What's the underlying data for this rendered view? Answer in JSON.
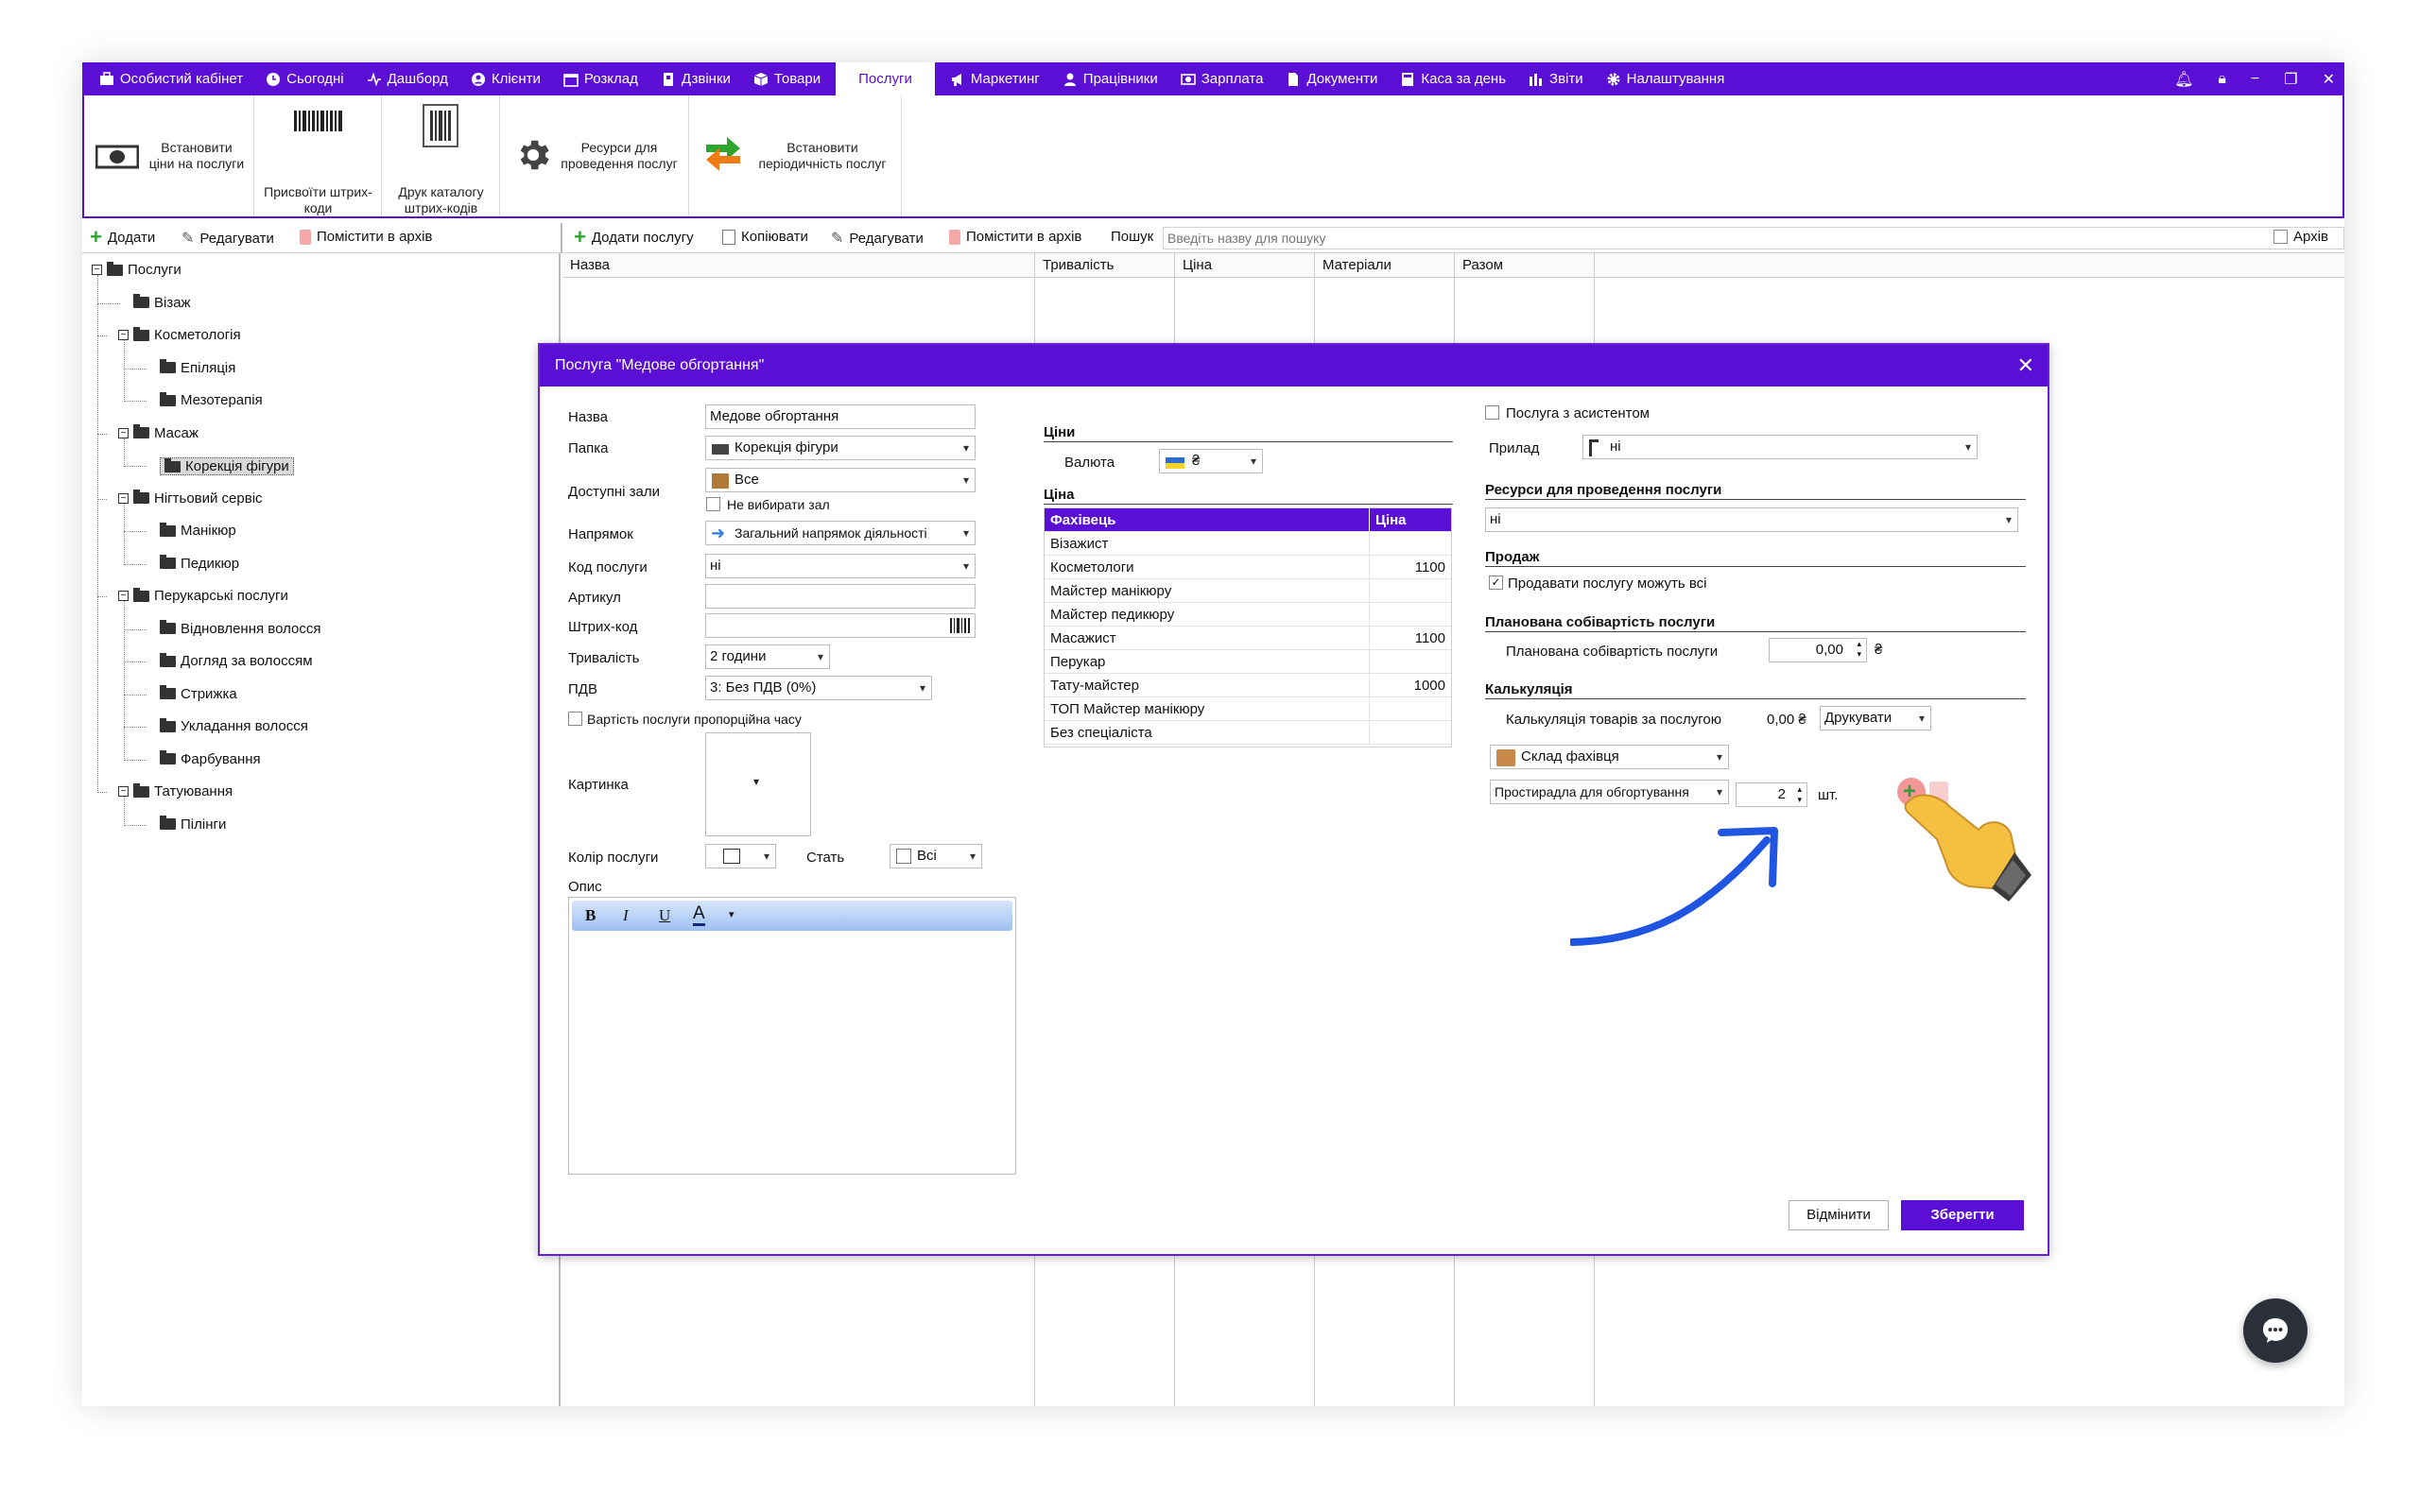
{
  "nav": {
    "items": [
      {
        "label": "Особистий кабінет",
        "icon": "briefcase-icon"
      },
      {
        "label": "Сьогодні",
        "icon": "clock-icon"
      },
      {
        "label": "Дашборд",
        "icon": "pulse-icon"
      },
      {
        "label": "Клієнти",
        "icon": "user-circle-icon"
      },
      {
        "label": "Розклад",
        "icon": "calendar-icon"
      },
      {
        "label": "Дзвінки",
        "icon": "phone-book-icon"
      },
      {
        "label": "Товари",
        "icon": "box-icon"
      },
      {
        "label": "Послуги",
        "icon": "",
        "active": true
      },
      {
        "label": "Маркетинг",
        "icon": "megaphone-icon"
      },
      {
        "label": "Працівники",
        "icon": "person-icon"
      },
      {
        "label": "Зарплата",
        "icon": "money-icon"
      },
      {
        "label": "Документи",
        "icon": "document-icon"
      },
      {
        "label": "Каса за день",
        "icon": "register-icon"
      },
      {
        "label": "Звіти",
        "icon": "bar-chart-icon"
      },
      {
        "label": "Налаштування",
        "icon": "gear-icon"
      }
    ],
    "window_controls": [
      "bell-icon",
      "lock-icon",
      "minimize-icon",
      "restore-icon",
      "close-icon"
    ]
  },
  "ribbon": {
    "set_prices": "Встановити\nціни на послуги",
    "assign_barcodes": "Присвоїти штрих-\nкоди",
    "print_catalog": "Друк каталогу\nштрих-кодів",
    "resources": "Ресурси для\nпроведення послуг",
    "periodicity": "Встановити\nперіодичність послуг"
  },
  "left_toolbar": {
    "add": "Додати",
    "edit": "Редагувати",
    "archive": "Помістити в архів"
  },
  "right_toolbar": {
    "add_service": "Додати послугу",
    "copy": "Копіювати",
    "edit": "Редагувати",
    "archive": "Помістити в архів",
    "search_label": "Пошук",
    "search_placeholder": "Введіть назву для пошуку",
    "archive_checkbox": "Архів"
  },
  "tree": [
    {
      "label": "Послуги",
      "level": 0,
      "expander": "−"
    },
    {
      "label": "Візаж",
      "level": 1
    },
    {
      "label": "Косметологія",
      "level": 1,
      "expander": "−"
    },
    {
      "label": "Епіляція",
      "level": 2
    },
    {
      "label": "Мезотерапія",
      "level": 2
    },
    {
      "label": "Масаж",
      "level": 1,
      "expander": "−"
    },
    {
      "label": "Корекція фігури",
      "level": 2,
      "selected": true
    },
    {
      "label": "Нігтьовий сервіс",
      "level": 1,
      "expander": "−"
    },
    {
      "label": "Манікюр",
      "level": 2
    },
    {
      "label": "Педикюр",
      "level": 2
    },
    {
      "label": "Перукарські послуги",
      "level": 1,
      "expander": "−"
    },
    {
      "label": "Відновлення волосся",
      "level": 2
    },
    {
      "label": "Догляд за волоссям",
      "level": 2
    },
    {
      "label": "Стрижка",
      "level": 2
    },
    {
      "label": "Укладання волосся",
      "level": 2
    },
    {
      "label": "Фарбування",
      "level": 2
    },
    {
      "label": "Татуювання",
      "level": 1,
      "expander": "−"
    },
    {
      "label": "Пілінги",
      "level": 2
    }
  ],
  "grid_columns": [
    "Назва",
    "Тривалість",
    "Ціна",
    "Матеріали",
    "Разом"
  ],
  "dialog": {
    "title": "Послуга \"Медове обгортання\"",
    "labels": {
      "name": "Назва",
      "folder": "Папка",
      "halls": "Доступні зали",
      "direction": "Напрямок",
      "code": "Код послуги",
      "article": "Артикул",
      "barcode": "Штрих-код",
      "duration": "Тривалість",
      "vat": "ПДВ",
      "picture": "Картинка",
      "color": "Колір послуги",
      "gender": "Стать",
      "description": "Опис"
    },
    "values": {
      "name": "Медове обгортання",
      "folder": "Корекція фігури",
      "halls": "Все",
      "no_halls": "Не вибирати зал",
      "direction": "Загальний напрямок діяльності",
      "code": "ні",
      "article": "",
      "barcode": "",
      "duration": "2 години",
      "vat": "3: Без ПДВ (0%)",
      "proportional": "Вартість послуги пропорційна часу",
      "gender": "Всі"
    },
    "editor": {
      "bold": "B",
      "italic": "I",
      "underline": "U"
    },
    "prices": {
      "section": "Ціни",
      "currency_label": "Валюта",
      "currency": "₴",
      "price_section": "Ціна",
      "header_specialist": "Фахівець",
      "header_price": "Ціна",
      "rows": [
        {
          "specialist": "Візажист",
          "price": ""
        },
        {
          "specialist": "Косметологи",
          "price": "1100"
        },
        {
          "specialist": "Майстер манікюру",
          "price": ""
        },
        {
          "specialist": "Майстер педикюру",
          "price": ""
        },
        {
          "specialist": "Масажист",
          "price": "1100"
        },
        {
          "specialist": "Перукар",
          "price": ""
        },
        {
          "specialist": "Тату-майстер",
          "price": "1000"
        },
        {
          "specialist": "ТОП Майстер манікюру",
          "price": ""
        },
        {
          "specialist": "Без спеціаліста",
          "price": ""
        }
      ]
    },
    "right": {
      "assistant": "Послуга з асистентом",
      "device_label": "Прилад",
      "device": "ні",
      "resources_section": "Ресурси для проведення послуги",
      "resources": "ні",
      "sale_section": "Продаж",
      "sale_all": "Продавати послугу можуть всі",
      "cost_section": "Планована собівартість послуги",
      "cost_label": "Планована собівартість послуги",
      "cost_value": "0,00",
      "cost_currency": "₴",
      "calc_section": "Калькуляція",
      "calc_label": "Калькуляція товарів за послугою",
      "calc_value": "0,00 ₴",
      "print": "Друкувати",
      "warehouse": "Склад фахівця",
      "product": "Простирадла для обгортування",
      "qty": "2",
      "unit": "шт."
    },
    "cancel": "Відмінити",
    "save": "Зберегти"
  },
  "colors": {
    "accent": "#5b0fd4",
    "arrow": "#1f55e0"
  }
}
